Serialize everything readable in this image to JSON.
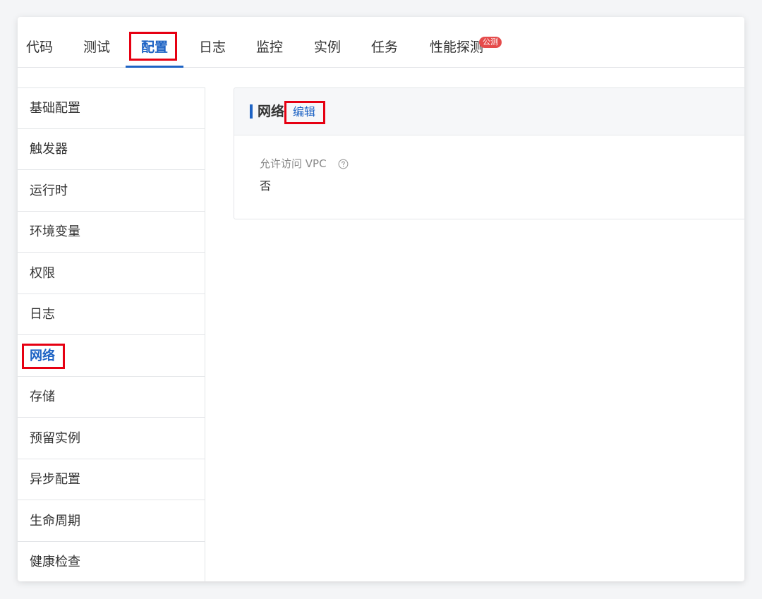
{
  "tabs": [
    {
      "label": "代码"
    },
    {
      "label": "测试"
    },
    {
      "label": "配置"
    },
    {
      "label": "日志"
    },
    {
      "label": "监控"
    },
    {
      "label": "实例"
    },
    {
      "label": "任务"
    },
    {
      "label": "性能探测",
      "badge": "公测"
    }
  ],
  "active_tab": "配置",
  "sidebar": {
    "items": [
      {
        "label": "基础配置"
      },
      {
        "label": "触发器"
      },
      {
        "label": "运行时"
      },
      {
        "label": "环境变量"
      },
      {
        "label": "权限"
      },
      {
        "label": "日志"
      },
      {
        "label": "网络"
      },
      {
        "label": "存储"
      },
      {
        "label": "预留实例"
      },
      {
        "label": "异步配置"
      },
      {
        "label": "生命周期"
      },
      {
        "label": "健康检查"
      }
    ],
    "active": "网络"
  },
  "panel": {
    "title": "网络",
    "edit_label": "编辑",
    "field_label": "允许访问 VPC",
    "field_value": "否",
    "help_icon": "question-circle-icon"
  },
  "colors": {
    "accent": "#1e63c4",
    "highlight": "#e60012",
    "badge": "#e54b4b"
  }
}
